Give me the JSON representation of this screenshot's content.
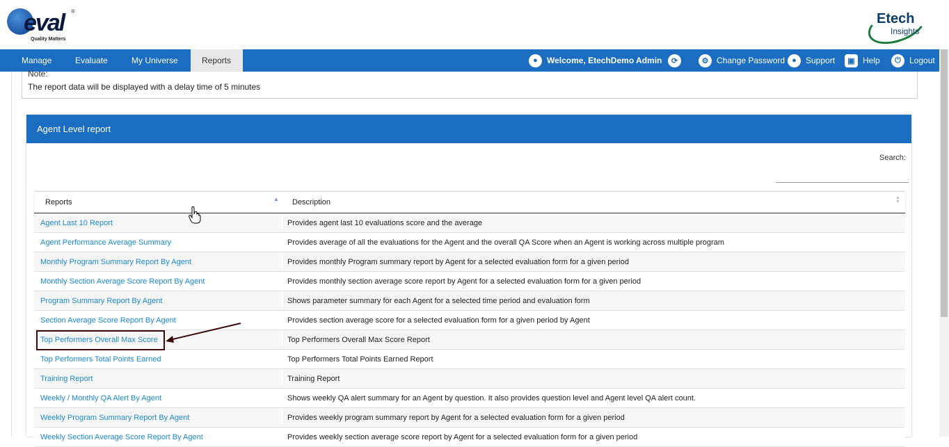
{
  "branding": {
    "left_logo_text": "Q-eval",
    "left_logo_tagline": "Quality Matters",
    "right_logo_text": "Etech",
    "right_logo_sub": "Insights"
  },
  "nav": {
    "items": [
      {
        "label": "Manage",
        "active": false
      },
      {
        "label": "Evaluate",
        "active": false
      },
      {
        "label": "My Universe",
        "active": false
      },
      {
        "label": "Reports",
        "active": true
      }
    ],
    "welcome": "Welcome, EtechDemo Admin",
    "change_password": "Change Password",
    "support": "Support",
    "help": "Help",
    "logout": "Logout"
  },
  "note": {
    "title": "Note:",
    "text": "The report data will be displayed with a delay time of 5 minutes"
  },
  "panel": {
    "title": "Agent Level report",
    "search_label": "Search:",
    "search_value": ""
  },
  "table": {
    "headers": [
      "Reports",
      "Description"
    ],
    "rows": [
      {
        "report": "Agent Last 10 Report",
        "description": "Provides agent last 10 evaluations score and the average"
      },
      {
        "report": "Agent Performance Average Summary",
        "description": "Provides average of all the evaluations for the Agent and the overall QA Score when an Agent is working across multiple program"
      },
      {
        "report": "Monthly Program Summary Report By Agent",
        "description": "Provides monthly Program summary report by Agent for a selected evaluation form for a given period"
      },
      {
        "report": "Monthly Section Average Score Report By Agent",
        "description": "Provides monthly section average score report by Agent for a selected evaluation form for a given period"
      },
      {
        "report": "Program Summary Report By Agent",
        "description": "Shows parameter summary for each Agent for a selected time period and evaluation form"
      },
      {
        "report": "Section Average Score Report By Agent",
        "description": "Provides section average score for a selected evaluation form for a given period by Agent"
      },
      {
        "report": "Top Performers Overall Max Score",
        "description": "Top Performers Overall Max Score Report"
      },
      {
        "report": "Top Performers Total Points Earned",
        "description": "Top Performers Total Points Earned Report"
      },
      {
        "report": "Training Report",
        "description": "Training Report"
      },
      {
        "report": "Weekly / Monthly QA Alert By Agent",
        "description": "Shows weekly QA alert summary for an Agent by question. It also provides question level and Agent level QA alert count."
      },
      {
        "report": "Weekly Program Summary Report By Agent",
        "description": "Provides weekly program summary report by Agent for a selected evaluation form for a given period"
      },
      {
        "report": "Weekly Section Average Score Report By Agent",
        "description": "Provides weekly section average score report by Agent for a selected evaluation form for a given period"
      }
    ]
  },
  "colors": {
    "nav_bg": "#1b6dc1",
    "link": "#1a86d4",
    "highlight_border": "#3b0a0a"
  }
}
